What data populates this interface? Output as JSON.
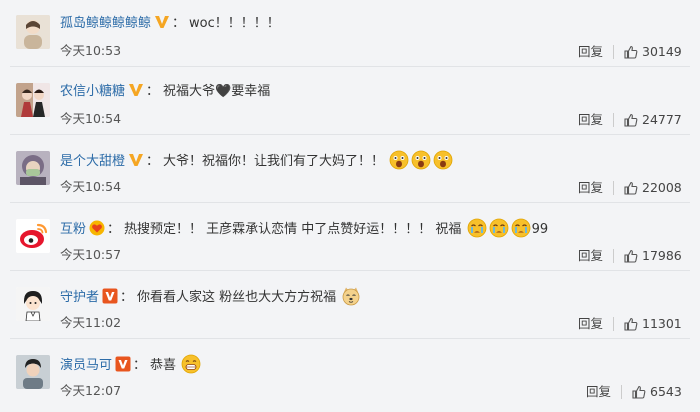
{
  "comments": [
    {
      "username": "孤岛鲸鲸鲸鲸鲸",
      "badge": "v-yellow",
      "text": "woc！！！！！",
      "emojis": [],
      "suffix": "",
      "time": "今天10:53",
      "reply_label": "回复",
      "likes": "30149",
      "avatar_color": "#d9c7ae"
    },
    {
      "username": "农信小糖糖",
      "badge": "v-yellow",
      "text": "祝福大爷🖤要幸福",
      "emojis": [],
      "suffix": "",
      "time": "今天10:54",
      "reply_label": "回复",
      "likes": "24777",
      "avatar_color": "#b54a4a"
    },
    {
      "username": "是个大甜橙",
      "badge": "v-yellow",
      "text": "大爷！祝福你！让我们有了大妈了！！",
      "emojis": [
        "surprised-emoji",
        "surprised-emoji",
        "surprised-emoji"
      ],
      "suffix": "",
      "time": "今天10:54",
      "reply_label": "回复",
      "likes": "22008",
      "avatar_color": "#8f8a9c"
    },
    {
      "username": "互粉",
      "badge": "fans-badge",
      "text": "热搜预定！！ 王彦霖承认恋情 中了点赞好运！！！！ 祝福",
      "emojis": [
        "cry-emoji",
        "cry-emoji",
        "cry-emoji"
      ],
      "suffix": "99",
      "time": "今天10:57",
      "reply_label": "回复",
      "likes": "17986",
      "avatar_color": "#ffffff"
    },
    {
      "username": "守护者",
      "badge": "v-orange",
      "text": "你看看人家这 粉丝也大大方方祝福",
      "emojis": [
        "doge-emoji"
      ],
      "suffix": "",
      "time": "今天11:02",
      "reply_label": "回复",
      "likes": "11301",
      "avatar_color": "#eeeeee"
    },
    {
      "username": "演员马可",
      "badge": "v-orange",
      "text": "恭喜",
      "emojis": [
        "grin-emoji"
      ],
      "suffix": "",
      "time": "今天12:07",
      "reply_label": "回复",
      "likes": "6543",
      "avatar_color": "#a7b1b8"
    }
  ],
  "colors": {
    "username": "#2d6ca8",
    "background": "#f3f4f6",
    "v_yellow": "#f5a623",
    "v_orange": "#e8551e"
  },
  "icons": {
    "like": "thumbs-up-icon"
  }
}
